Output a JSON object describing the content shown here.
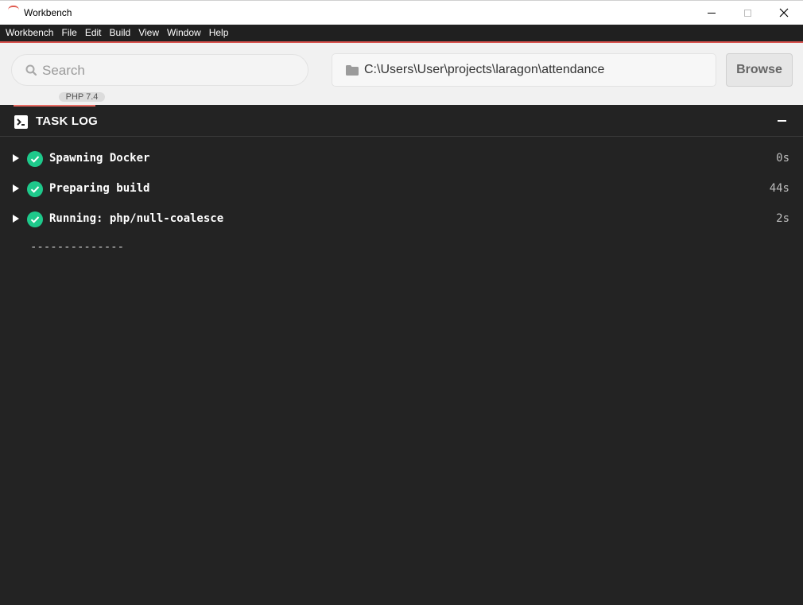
{
  "window": {
    "title": "Workbench"
  },
  "menu": {
    "items": [
      "Workbench",
      "File",
      "Edit",
      "Build",
      "View",
      "Window",
      "Help"
    ]
  },
  "toolbar": {
    "search_placeholder": "Search",
    "path_value": "C:\\Users\\User\\projects\\laragon\\attendance",
    "browse_label": "Browse",
    "peek_badge": "PHP 7.4"
  },
  "task_log": {
    "title": "TASK LOG",
    "tasks": [
      {
        "label": "Spawning Docker",
        "time": "0s",
        "status": "success"
      },
      {
        "label": "Preparing build",
        "time": "44s",
        "status": "success"
      },
      {
        "label": "Running: php/null-coalesce",
        "time": "2s",
        "status": "success"
      }
    ],
    "separator": "--------------"
  },
  "colors": {
    "accent": "#e86b63",
    "success": "#1ec98b",
    "panel_bg": "#232323",
    "menubar_bg": "#202020"
  },
  "icons": {
    "search": "search-icon",
    "folder": "folder-icon",
    "terminal": "terminal-icon",
    "check": "check-circle-icon",
    "expand": "caret-right-icon"
  }
}
